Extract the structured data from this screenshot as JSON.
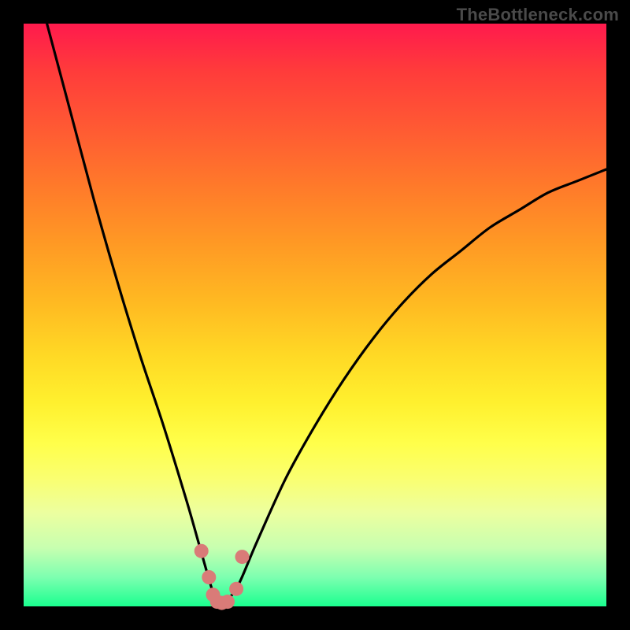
{
  "watermark": {
    "text": "TheBottleneck.com"
  },
  "colors": {
    "gradient_top": "#ff1a4d",
    "gradient_bottom": "#1aff8f",
    "curve_stroke": "#000000",
    "marker_fill": "#d97b78",
    "frame": "#000000"
  },
  "chart_data": {
    "type": "line",
    "title": "",
    "xlabel": "",
    "ylabel": "",
    "xlim": [
      0,
      100
    ],
    "ylim": [
      0,
      100
    ],
    "grid": false,
    "legend": false,
    "series": [
      {
        "name": "bottleneck-curve",
        "description": "V-shaped curve; y ≈ 100 at x≈4, drops to ~0 near x≈33, rises to ~75 at x≈100",
        "x": [
          4,
          8,
          12,
          16,
          20,
          24,
          28,
          30,
          32,
          33,
          34,
          35,
          37,
          40,
          45,
          50,
          55,
          60,
          65,
          70,
          75,
          80,
          85,
          90,
          95,
          100
        ],
        "y": [
          100,
          85,
          70,
          56,
          43,
          31,
          18,
          11,
          4,
          1,
          0,
          1,
          4,
          11,
          22,
          31,
          39,
          46,
          52,
          57,
          61,
          65,
          68,
          71,
          73,
          75
        ]
      }
    ],
    "markers": {
      "description": "Highlighted near-bottleneck segment around the minimum",
      "x": [
        30.5,
        31.8,
        32.5,
        33.2,
        34.0,
        35.0,
        36.5,
        37.5
      ],
      "y": [
        9.5,
        5.0,
        2.0,
        0.8,
        0.6,
        0.8,
        3.0,
        8.5
      ]
    }
  }
}
